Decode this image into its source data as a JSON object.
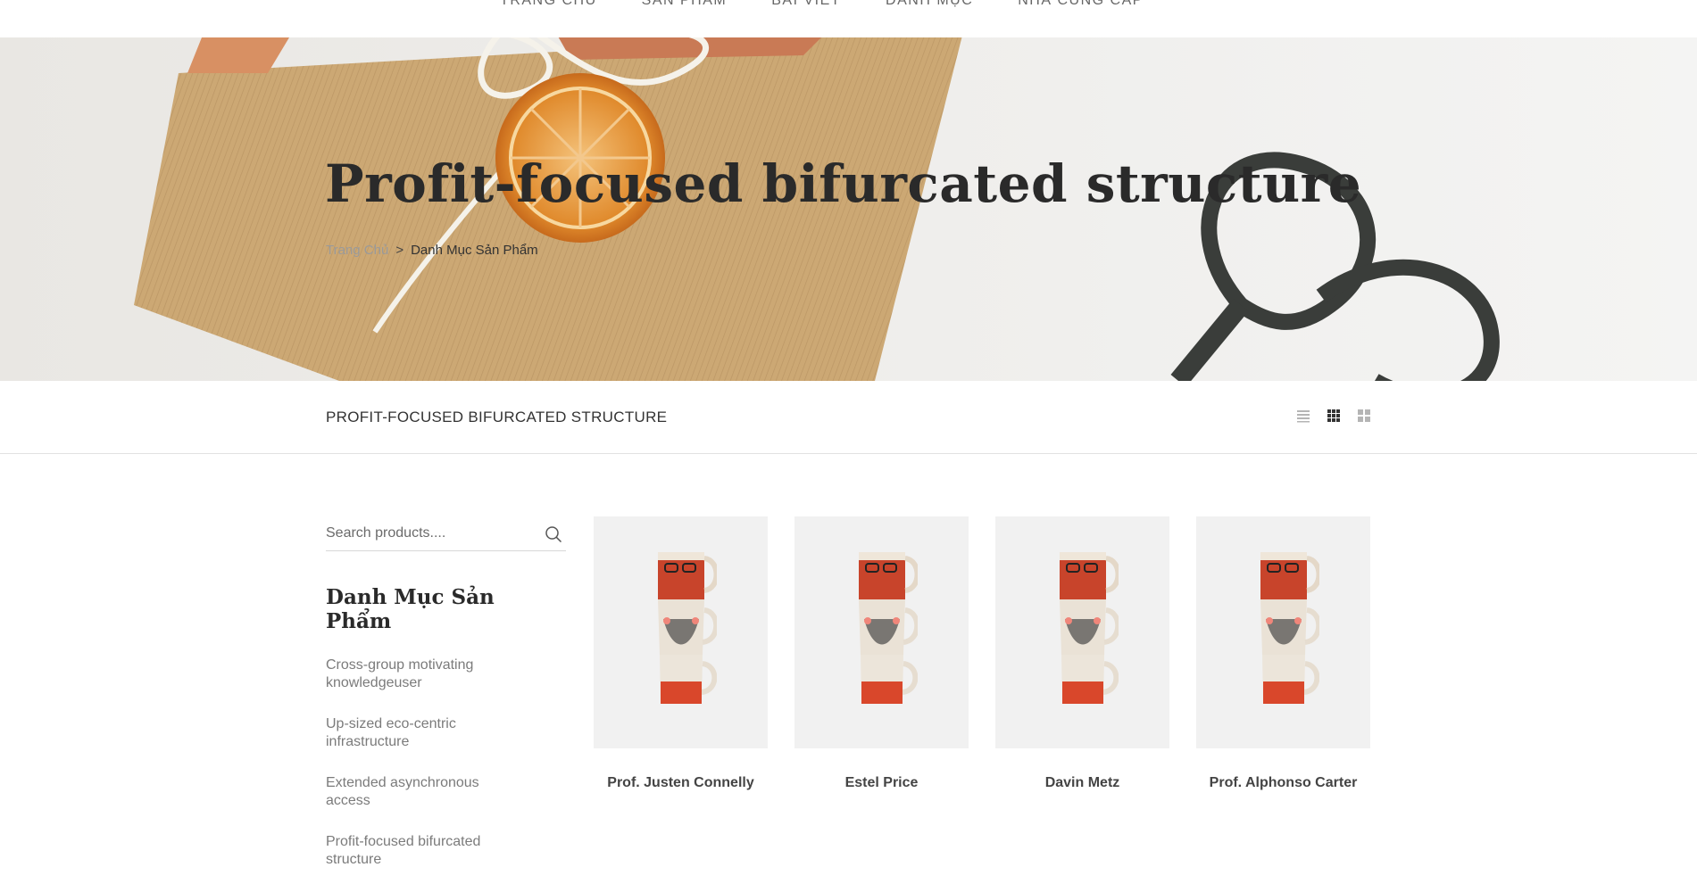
{
  "nav": {
    "items": [
      "TRANG CHỦ",
      "SẢN PHẨM",
      "BÀI VIẾT",
      "DANH MỤC",
      "NHÀ CUNG CẤP"
    ]
  },
  "hero": {
    "title": "Profit-focused bifurcated structure",
    "breadcrumb": {
      "home": "Trang Chủ",
      "separator": ">",
      "current": "Danh Mục Sản Phẩm"
    }
  },
  "toolbar": {
    "title": "PROFIT-FOCUSED BIFURCATED STRUCTURE",
    "view_icons": [
      "list-view-icon",
      "grid-view-icon",
      "large-grid-view-icon"
    ]
  },
  "sidebar": {
    "search_placeholder": "Search products....",
    "category_title": "Danh Mục Sản Phẩm",
    "categories": [
      "Cross-group motivating knowledgeuser",
      "Up-sized eco-centric infrastructure",
      "Extended asynchronous access",
      "Profit-focused bifurcated structure"
    ]
  },
  "products": [
    {
      "name": "Prof. Justen Connelly"
    },
    {
      "name": "Estel Price"
    },
    {
      "name": "Davin Metz"
    },
    {
      "name": "Prof. Alphonso Carter"
    }
  ],
  "colors": {
    "accent": "#2a2a2a",
    "muted": "#7b7b7b",
    "card_bg": "#f1f1f1"
  }
}
